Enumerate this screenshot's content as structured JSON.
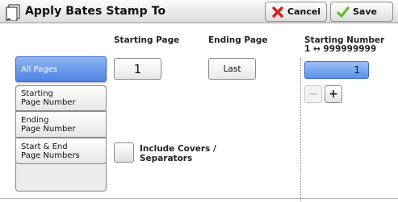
{
  "window": {
    "title": "Apply Bates Stamp To"
  },
  "toolbar": {
    "cancel_label": "Cancel",
    "save_label": "Save",
    "cancel_icon": "red-x-icon",
    "save_icon": "green-check-icon",
    "title_icon": "bates-stamp-icon"
  },
  "headers": {
    "starting_page": "Starting Page",
    "ending_page": "Ending Page",
    "starting_number": "Starting Number",
    "range": "1 ↔ 999999999"
  },
  "sidebar": {
    "items": [
      {
        "label": "All Pages",
        "selected": true
      },
      {
        "label": "Starting\nPage Number",
        "selected": false
      },
      {
        "label": "Ending\nPage Number",
        "selected": false
      },
      {
        "label": "Start & End\nPage Numbers",
        "selected": false
      }
    ]
  },
  "fields": {
    "starting_page_value": "1",
    "ending_page_value": "Last",
    "starting_number_value": "1"
  },
  "stepper": {
    "minus": "−",
    "plus": "+"
  },
  "checkbox": {
    "label": "Include Covers /\nSeparators",
    "checked": false
  },
  "colors": {
    "selected": "#5b92ea",
    "cancel_icon": "#d91f1f",
    "save_icon": "#5fbf2a"
  }
}
